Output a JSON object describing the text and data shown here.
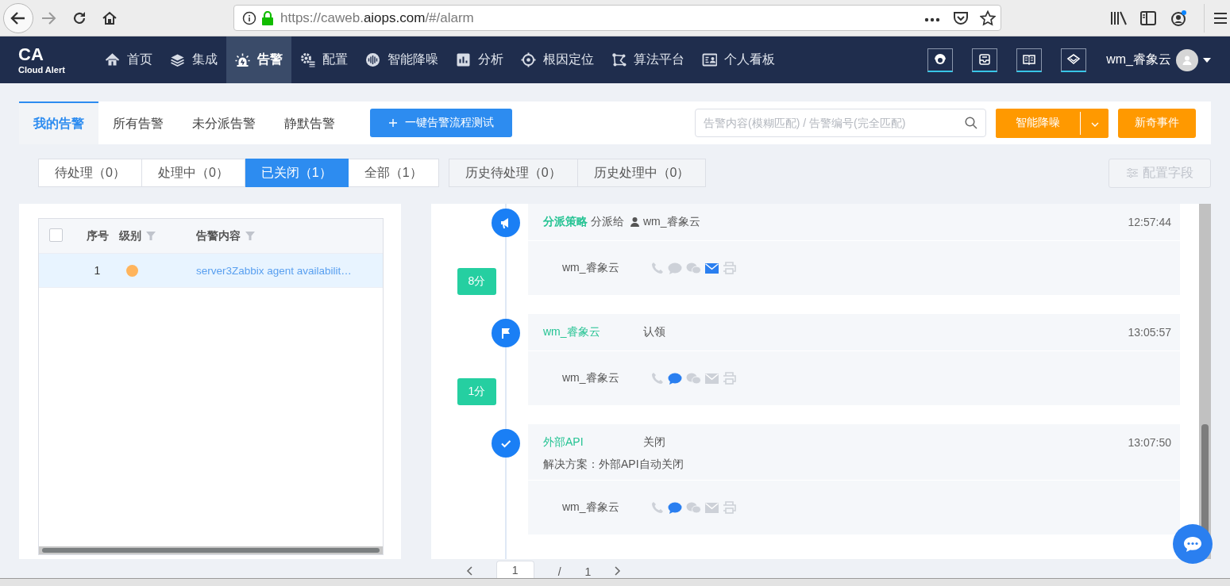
{
  "browser": {
    "url": "https://caweb.**aiops.com**/#/alarm"
  },
  "nav": {
    "logo": {
      "title": "CA",
      "subtitle": "Cloud Alert"
    },
    "items": [
      {
        "label": "首页",
        "selected": false
      },
      {
        "label": "集成",
        "selected": false
      },
      {
        "label": "告警",
        "selected": true
      },
      {
        "label": "配置",
        "selected": false
      },
      {
        "label": "智能降噪",
        "selected": false
      },
      {
        "label": "分析",
        "selected": false
      },
      {
        "label": "根因定位",
        "selected": false
      },
      {
        "label": "算法平台",
        "selected": false
      },
      {
        "label": "个人看板",
        "selected": false
      }
    ],
    "user": "wm_睿象云"
  },
  "tabs": [
    {
      "label": "我的告警",
      "selected": true
    },
    {
      "label": "所有告警",
      "selected": false
    },
    {
      "label": "未分派告警",
      "selected": false
    },
    {
      "label": "静默告警",
      "selected": false
    }
  ],
  "test_button": "一键告警流程测试",
  "search": {
    "placeholder": "告警内容(模糊匹配) / 告警编号(完全匹配)"
  },
  "noise_button": "智能降噪",
  "novel_button": "新奇事件",
  "status_tabs": [
    {
      "label": "待处理（0）",
      "selected": false
    },
    {
      "label": "处理中（0）",
      "selected": false
    },
    {
      "label": "已关闭（1）",
      "selected": true
    },
    {
      "label": "全部（1）",
      "selected": false
    }
  ],
  "history_tabs": [
    {
      "label": "历史待处理（0）",
      "selected": false
    },
    {
      "label": "历史处理中（0）",
      "selected": false
    }
  ],
  "config_button": {
    "label": "配置字段",
    "disabled": true
  },
  "table": {
    "header_checkbox": {
      "checked": false
    },
    "columns": [
      {
        "label": "序号",
        "filter": false
      },
      {
        "label": "级别",
        "filter": true
      },
      {
        "label": "告警内容",
        "filter": true
      }
    ],
    "rows": [
      {
        "index": "1",
        "color": "#ffb45c",
        "content": "server3Zabbix agent availabilit…",
        "selected": true
      }
    ]
  },
  "timeline": [
    {
      "kind": "assign",
      "actor": "分派策略",
      "action": "分派给",
      "assignee": "wm_睿象云",
      "time": "12:57:44",
      "user": "wm_睿象云",
      "duration": "8分",
      "channels": [
        {
          "kind": "phone",
          "on": false
        },
        {
          "kind": "sms",
          "on": false
        },
        {
          "kind": "wechat",
          "on": false
        },
        {
          "kind": "email",
          "on": true
        },
        {
          "kind": "fax",
          "on": false
        }
      ]
    },
    {
      "kind": "claim",
      "actor": "wm_睿象云",
      "action": "认领",
      "time": "13:05:57",
      "user": "wm_睿象云",
      "duration": "1分",
      "channels": [
        {
          "kind": "phone",
          "on": false
        },
        {
          "kind": "sms",
          "on": true
        },
        {
          "kind": "wechat",
          "on": false
        },
        {
          "kind": "email",
          "on": false
        },
        {
          "kind": "fax",
          "on": false
        }
      ]
    },
    {
      "kind": "close",
      "actor": "外部API",
      "action": "关闭",
      "time": "13:07:50",
      "note": "解决方案：外部API自动关闭",
      "user": "wm_睿象云",
      "channels": [
        {
          "kind": "phone",
          "on": false
        },
        {
          "kind": "sms",
          "on": true
        },
        {
          "kind": "wechat",
          "on": false
        },
        {
          "kind": "email",
          "on": false
        },
        {
          "kind": "fax",
          "on": false
        }
      ]
    }
  ],
  "pagination": {
    "page": "1",
    "separator": "/",
    "total": "1"
  }
}
